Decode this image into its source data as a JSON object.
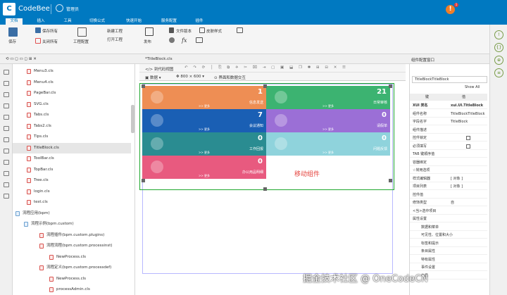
{
  "app": {
    "name": "CodeBee",
    "manage": "管理员",
    "notifications": "1"
  },
  "menu": [
    "文档",
    "插入",
    "工具",
    "切换公式",
    "快速开始",
    "服务配置",
    "插件"
  ],
  "ribbon": {
    "save": "保存",
    "save_all": "保存所有",
    "close_all": "关闭所有",
    "project_config": "工程配置",
    "new_project": "新建工程",
    "open_project": "打开工程",
    "publish": "发布",
    "file_version": "文件版本",
    "skin_style": "皮肤样式"
  },
  "editor_tab": "*TitleBlock.cls",
  "designer": {
    "toolbar_label": "到代码视图",
    "data_label": "数据",
    "size_label": "800 × 600",
    "interaction_label": "界面和数据交互"
  },
  "tree": [
    {
      "label": "Menu3.cls",
      "indent": 0
    },
    {
      "label": "Menu4.cls",
      "indent": 0
    },
    {
      "label": "PageBar.cls",
      "indent": 0
    },
    {
      "label": "SVG.cls",
      "indent": 0
    },
    {
      "label": "Tabs.cls",
      "indent": 0
    },
    {
      "label": "Tabs2.cls",
      "indent": 0
    },
    {
      "label": "Tips.cls",
      "indent": 0
    },
    {
      "label": "TitleBlock.cls",
      "indent": 0,
      "selected": true
    },
    {
      "label": "ToolBar.cls",
      "indent": 0
    },
    {
      "label": "TopBar.cls",
      "indent": 0
    },
    {
      "label": "Tree.cls",
      "indent": 0
    },
    {
      "label": "login.cls",
      "indent": 0
    },
    {
      "label": "test.cls",
      "indent": 0
    },
    {
      "label": "流程应用(bpm)",
      "indent": -2
    },
    {
      "label": "流程示例(bpm.custom)",
      "indent": -1
    },
    {
      "label": "流程插件(bpm.custom.plugins)",
      "indent": 1
    },
    {
      "label": "流程流程(bpm.custom.processinst)",
      "indent": 1
    },
    {
      "label": "NewProcess.cls",
      "indent": 2
    },
    {
      "label": "流程定义(bpm.custom.processdef)",
      "indent": 1
    },
    {
      "label": "NewProcess.cls",
      "indent": 2
    },
    {
      "label": "processAdmin.cls",
      "indent": 2
    }
  ],
  "tiles": [
    {
      "num": "1",
      "label": "信息发送",
      "more": ">> 更多",
      "color": "#ee8e54"
    },
    {
      "num": "21",
      "label": "日常审核",
      "more": ">> 更多",
      "color": "#3cb371"
    },
    {
      "num": "7",
      "label": "会议通知",
      "more": ">> 更多",
      "color": "#1a5fb4"
    },
    {
      "num": "0",
      "label": "请假单",
      "more": ">> 更多",
      "color": "#9b6fd6"
    },
    {
      "num": "0",
      "label": "工作回报",
      "more": ">> 更多",
      "color": "#2a8c91"
    },
    {
      "num": "0",
      "label": "问题反馈",
      "more": ">> 更多",
      "color": "#8fd3dc"
    },
    {
      "num": "0",
      "label": "办公用品明细",
      "more": ">> 更多",
      "color": "#e85a7f"
    }
  ],
  "move_label": "移动组件",
  "props": {
    "title": "组件配置窗口",
    "object_name": "TitleBlockTitleBlock",
    "show_all": "Show All",
    "col_key": "键",
    "col_val": "值",
    "rows": [
      {
        "k": "XUI 类名",
        "v": "xui.UI.TitleBlock",
        "bold": true
      },
      {
        "k": "组件名称",
        "v": "TitleBlockTitleBlock"
      },
      {
        "k": "字段名字",
        "v": "TitleBlock"
      },
      {
        "k": "组件描述",
        "v": ""
      },
      {
        "k": "控件锁定",
        "v": "checkbox"
      },
      {
        "k": "必须填写",
        "v": "checkbox"
      },
      {
        "k": "TAB 键顺序值",
        "v": ""
      },
      {
        "k": "容器绑定",
        "v": ""
      },
      {
        "k": "☆常用选项",
        "v": ""
      },
      {
        "k": "样式编辑器",
        "v": "[ 对象 ]"
      },
      {
        "k": "项目列表",
        "v": "[ 对象 ]"
      },
      {
        "k": "控件值",
        "v": ""
      },
      {
        "k": "修饰类型",
        "v": "自"
      },
      {
        "k": "<当>选中项目",
        "v": ""
      },
      {
        "k": "属性设置",
        "v": ""
      },
      {
        "k": "数据和菜单",
        "v": ""
      },
      {
        "k": "可见性、位置和大小",
        "v": ""
      },
      {
        "k": "标签和提示",
        "v": ""
      },
      {
        "k": "条目属性",
        "v": ""
      },
      {
        "k": "特有属性",
        "v": ""
      },
      {
        "k": "事件设置",
        "v": ""
      },
      {
        "k": "布局",
        "v": ""
      }
    ]
  },
  "watermark": "掘金技术社区 @ OneCodeCN"
}
